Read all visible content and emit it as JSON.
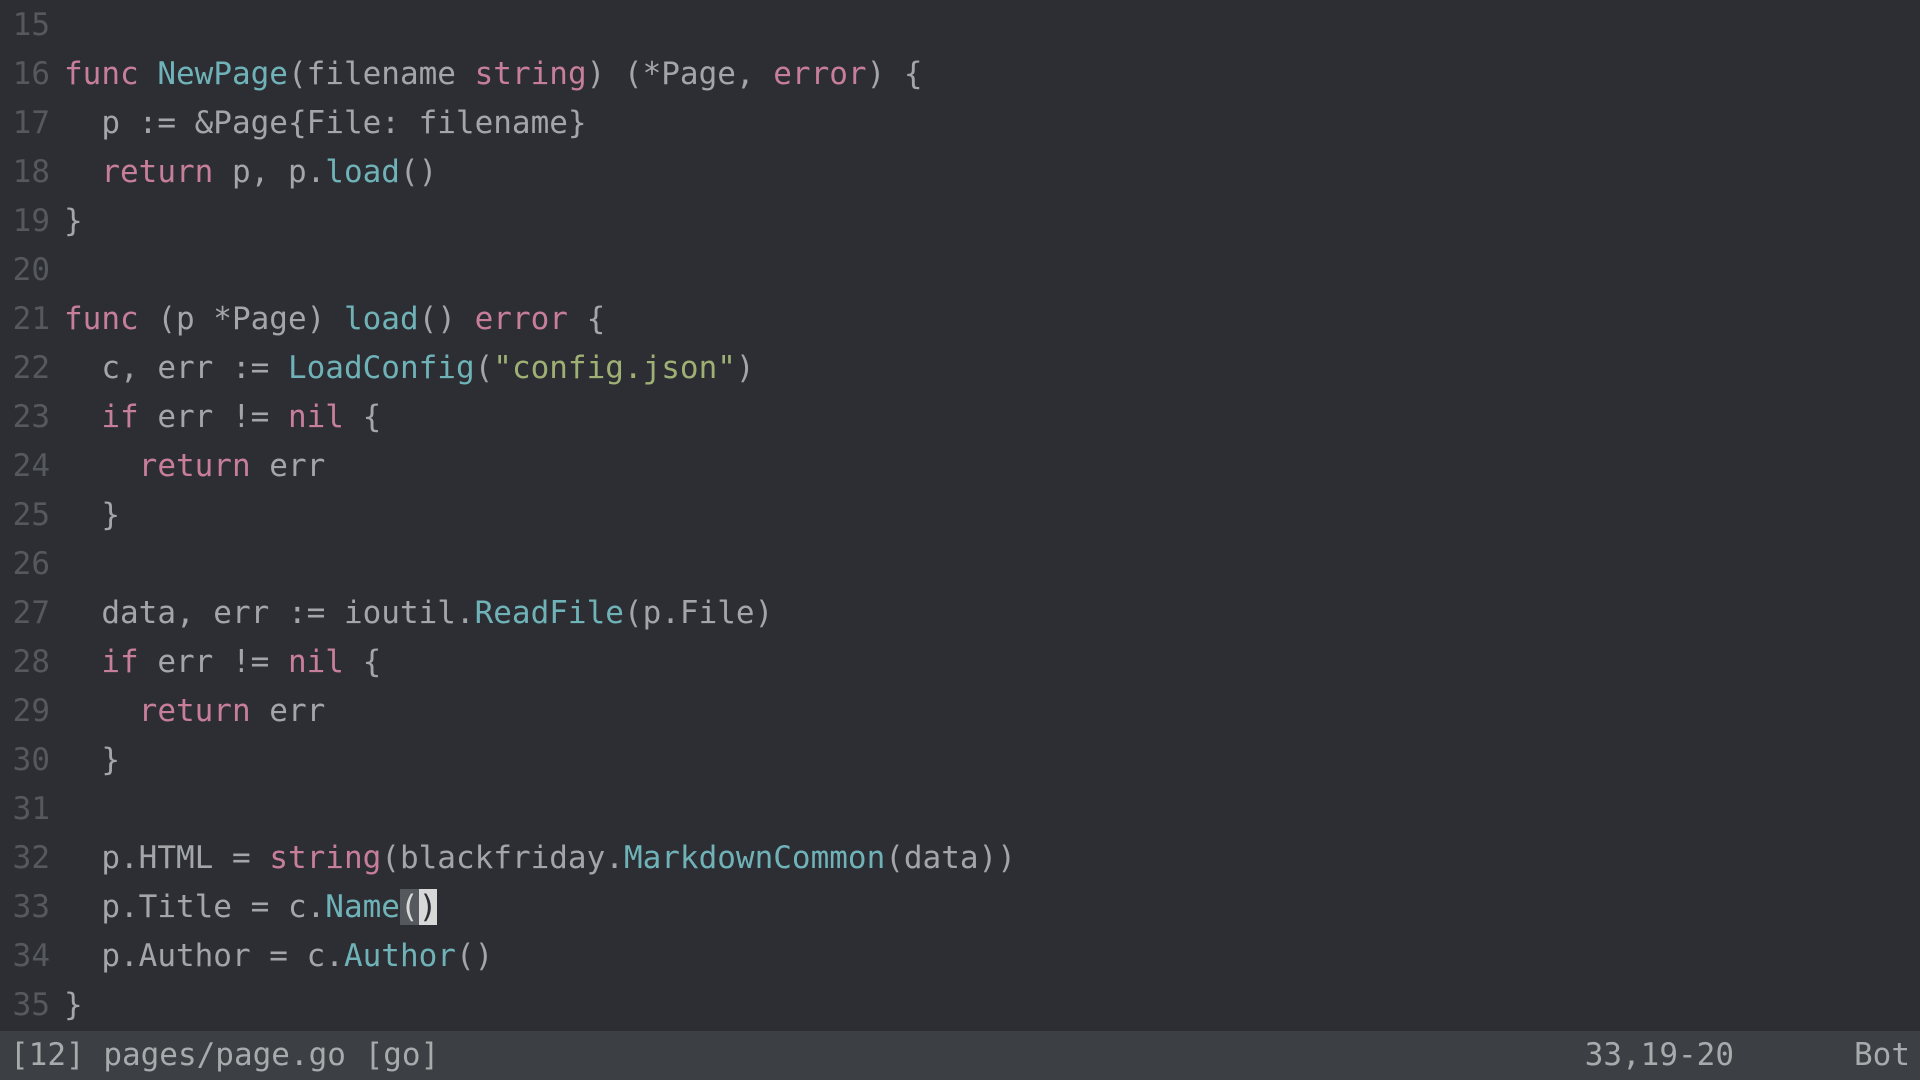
{
  "lines": {
    "15": "15",
    "16": "16",
    "17": "17",
    "18": "18",
    "19": "19",
    "20": "20",
    "21": "21",
    "22": "22",
    "23": "23",
    "24": "24",
    "25": "25",
    "26": "26",
    "27": "27",
    "28": "28",
    "29": "29",
    "30": "30",
    "31": "31",
    "32": "32",
    "33": "33",
    "34": "34",
    "35": "35"
  },
  "tok": {
    "func": "func",
    "return": "return",
    "if": "if",
    "nil": "nil",
    "error": "error",
    "string": "string",
    "NewPage": "NewPage",
    "load": "load",
    "LoadConfig": "LoadConfig",
    "ReadFile": "ReadFile",
    "MarkdownCommon": "MarkdownCommon",
    "Name": "Name",
    "Author": "Author",
    "config_json": "\"config.json\""
  },
  "txt": {
    "l16a": " ",
    "l16b": "(filename ",
    "l16c": ") (*Page, ",
    "l16d": ") {",
    "l17": "  p := &Page{File: filename}",
    "l18a": "  ",
    "l18b": " p, p.",
    "l18c": "()",
    "l19": "}",
    "l21a": " (p *Page) ",
    "l21b": "() ",
    "l21c": " {",
    "l22a": "  c, err := ",
    "l22b": "(",
    "l22c": ")",
    "l23a": "  ",
    "l23b": " err != ",
    "l23c": " {",
    "l24a": "    ",
    "l24b": " err",
    "l25": "  }",
    "l27a": "  data, err := ioutil.",
    "l27b": "(p.File)",
    "l28a": "  ",
    "l28b": " err != ",
    "l28c": " {",
    "l29a": "    ",
    "l29b": " err",
    "l30": "  }",
    "l32a": "  p.HTML = ",
    "l32b": "(blackfriday.",
    "l32c": "(data))",
    "l33a": "  p.Title = c.",
    "l33_match": "(",
    "l33_cursor": ")",
    "l34a": "  p.Author = c.",
    "l34b": "()",
    "l35": "}"
  },
  "status": {
    "left": "[12] pages/page.go [go]",
    "mid": "33,19-20",
    "right": "Bot"
  }
}
